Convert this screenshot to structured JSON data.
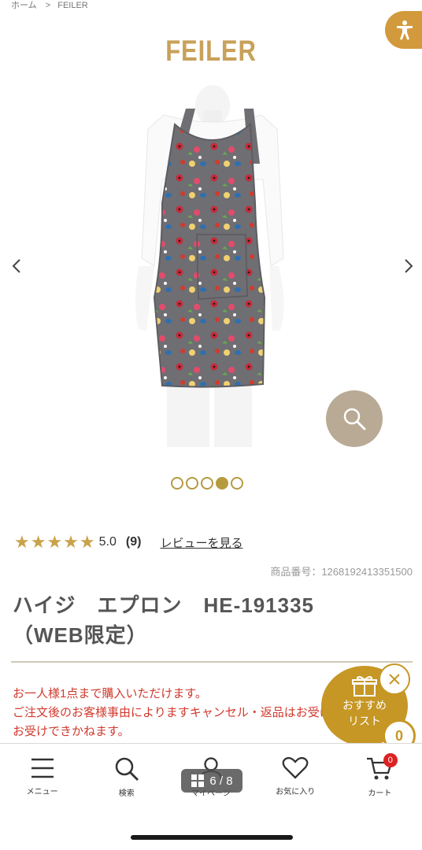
{
  "breadcrumb": {
    "home": "ホーム",
    "separator": ">",
    "current": "FEILER"
  },
  "brand": {
    "logo": "FEILER",
    "accent": "#c8a15a"
  },
  "gallery": {
    "indicator": "6 / 8",
    "dots_total": 5,
    "dots_active": 4
  },
  "rating": {
    "stars": "★★★★★",
    "score": "5.0",
    "count": "(9)",
    "review_link": "レビューを見る"
  },
  "product": {
    "number": "商品番号：1268192413351500",
    "title_line1": "ハイジ　エプロン　HE-191335",
    "title_line2": "（WEB限定）"
  },
  "notice": {
    "line1": "お一人様1点まで購入いただけます。",
    "line2": "ご注文後のお客様事由によりますキャンセル・返品はお受けできかねます。",
    "line3": "お受けできかねます。"
  },
  "recommend": {
    "label_line1": "おすすめ",
    "label_line2": "リスト",
    "count": "0",
    "color": "#c69724"
  },
  "nav": {
    "items": [
      {
        "label": "メニュー",
        "icon": "menu-icon"
      },
      {
        "label": "検索",
        "icon": "search-icon"
      },
      {
        "label": "マイページ",
        "icon": "user-icon"
      },
      {
        "label": "お気に入り",
        "icon": "heart-icon"
      },
      {
        "label": "カート",
        "icon": "cart-icon"
      }
    ],
    "cart_count": "0"
  }
}
